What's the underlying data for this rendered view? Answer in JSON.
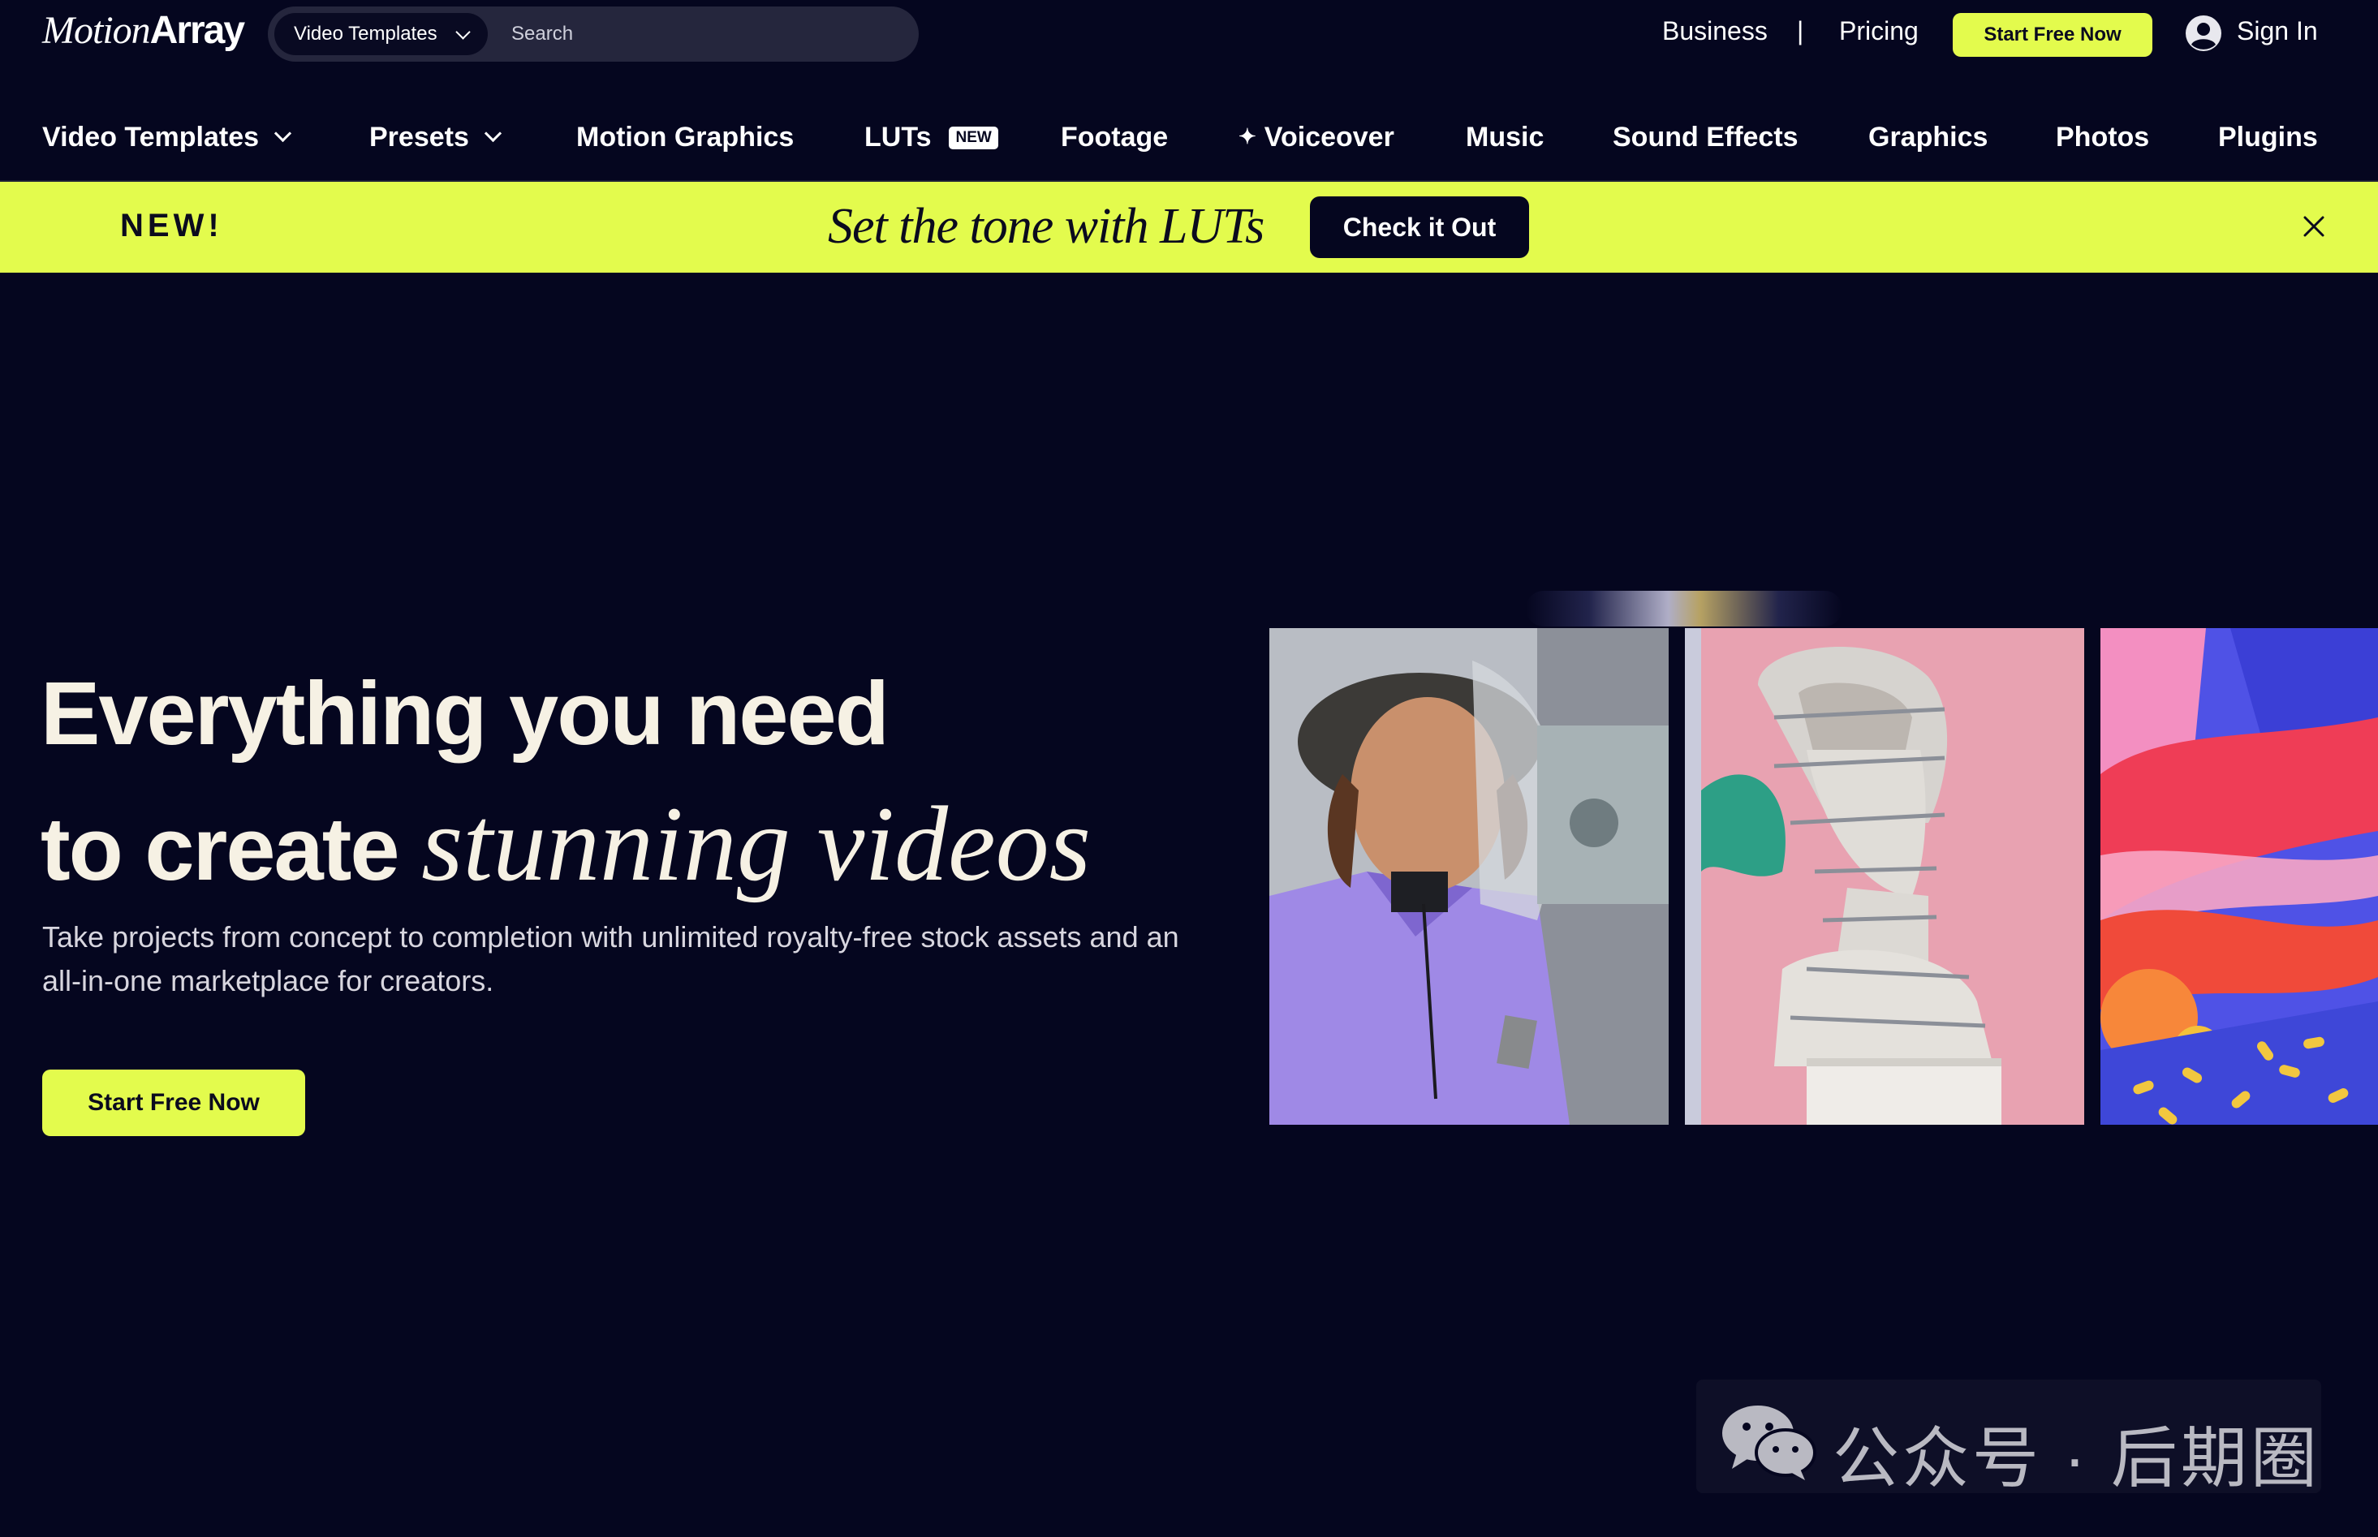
{
  "brand": {
    "logo_part1": "Motion",
    "logo_part2": "Array"
  },
  "search": {
    "category": "Video Templates",
    "placeholder": "Search"
  },
  "top_links": {
    "business": "Business",
    "separator": "|",
    "pricing": "Pricing",
    "start_free": "Start Free Now",
    "sign_in": "Sign In"
  },
  "nav": {
    "video_templates": "Video Templates",
    "presets": "Presets",
    "motion_graphics": "Motion Graphics",
    "luts": "LUTs",
    "luts_badge": "NEW",
    "footage": "Footage",
    "voiceover": "Voiceover",
    "music": "Music",
    "sound_effects": "Sound Effects",
    "graphics": "Graphics",
    "photos": "Photos",
    "plugins": "Plugins"
  },
  "promo": {
    "tag": "NEW!",
    "headline": "Set the tone with LUTs",
    "button": "Check it Out"
  },
  "hero": {
    "line1": "Everything you need",
    "line2_plain": "to create ",
    "line2_italic": "stunning videos",
    "subtitle": "Take projects from concept to completion with unlimited royalty-free stock assets and an all-in-one marketplace for creators.",
    "cta": "Start Free Now"
  },
  "watermark": {
    "text": "公众号 · 后期圈"
  },
  "colors": {
    "background": "#05061f",
    "accent": "#e3fb4d",
    "headline": "#f6f1e4"
  },
  "icons": {
    "search_dropdown": "chevron-down-icon",
    "account": "user-circle-icon",
    "voiceover": "sparkle-icon",
    "promo_close": "close-icon",
    "watermark": "wechat-icon"
  }
}
